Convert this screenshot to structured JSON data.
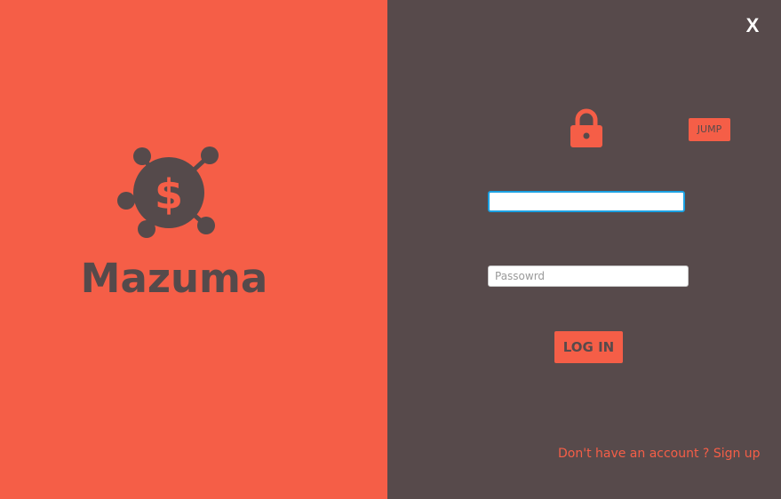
{
  "brand": {
    "name": "Mazuma",
    "logo_icon": "money-network-icon",
    "panel_color": "#F55E47",
    "text_color": "#554A4B"
  },
  "window": {
    "close_label": "X",
    "panel_color": "#574A4B"
  },
  "login_form": {
    "lock_icon": "lock-icon",
    "jump_label": "JUMP",
    "username_value": "",
    "password_placeholder": "Passowrd",
    "login_label": "LOG IN",
    "signup_text": "Don't have an account ? Sign up",
    "accent_color": "#F55E47",
    "focus_color": "#1BA1E2"
  }
}
